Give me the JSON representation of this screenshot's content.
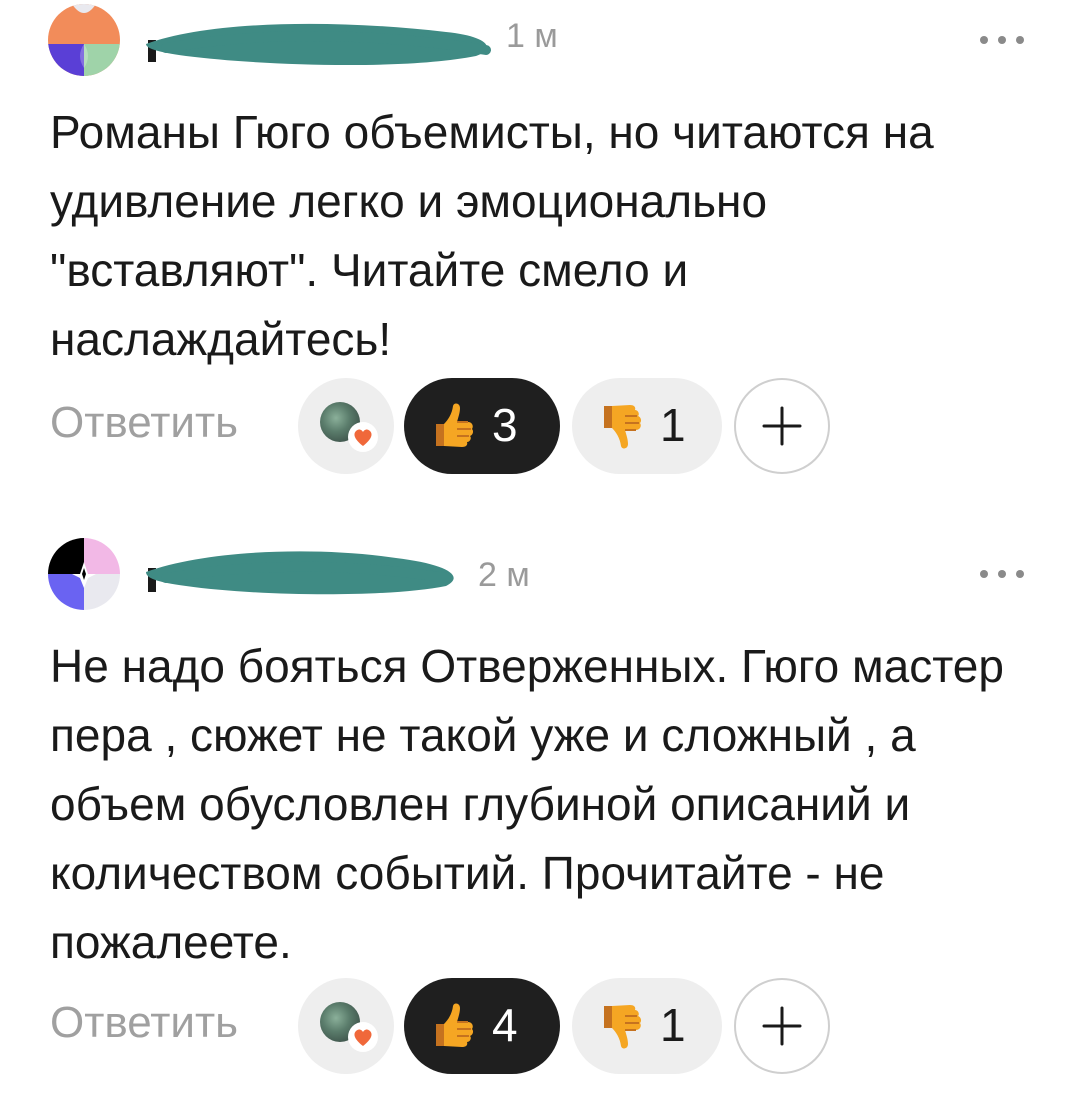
{
  "comments": [
    {
      "time": "1 м",
      "text": "Романы Гюго объемисты, но читаются на удивление легко и эмоционально \"вставляют\". Читайте смело и наслаждайтесь!",
      "reply_label": "Ответить",
      "likes": "3",
      "dislikes": "1",
      "avatar_colors": [
        "#f28c5a",
        "#5a3fd6",
        "#9fd3a9"
      ]
    },
    {
      "time": "2 м",
      "text": "Не надо бояться Отверженных. Гюго мастер пера , сюжет не такой уже и сложный , а объем обусловлен глубиной описаний и количеством событий. Прочитайте - не пожалеете.",
      "reply_label": "Ответить",
      "likes": "4",
      "dislikes": "1",
      "avatar_colors": [
        "#000000",
        "#f2b8e6",
        "#6a63f2",
        "#e9e9ef"
      ]
    }
  ],
  "icons": {
    "more": "more-horizontal-icon",
    "like": "thumbs-up-emoji-icon",
    "dislike": "thumbs-down-emoji-icon",
    "add": "plus-icon"
  },
  "colors": {
    "redaction": "#3f8b84",
    "like_pill": "#1f1f1f",
    "secondary_text": "#9a9a9a"
  }
}
